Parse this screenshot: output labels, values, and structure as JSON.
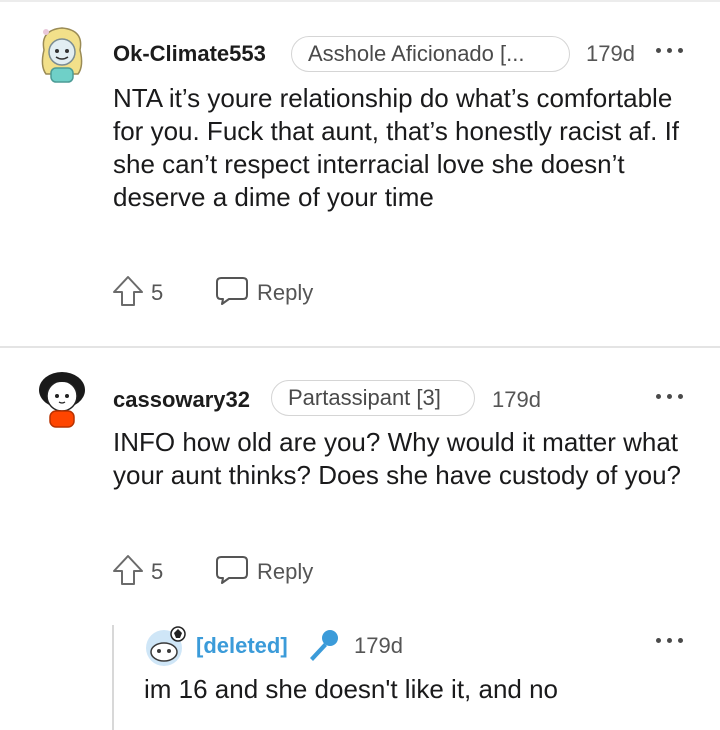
{
  "comments": [
    {
      "username": "Ok-Climate553",
      "flair": "Asshole Aficionado [...",
      "time": "179d",
      "text": "NTA it’s youre relationship do what’s comfortable for you. Fuck that aunt, that’s honestly racist af. If she can’t respect interracial love she doesn’t deserve a dime of your time",
      "votes": "5",
      "reply_label": "Reply"
    },
    {
      "username": "cassowary32",
      "flair": "Partassipant [3]",
      "time": "179d",
      "text": "INFO how old are you? Why would it matter what your aunt thinks? Does she have custody of you?",
      "votes": "5",
      "reply_label": "Reply"
    }
  ],
  "reply": {
    "username": "[deleted]",
    "time": "179d",
    "text": "im 16 and she doesn't like it, and no",
    "badge_icon": "microphone-icon",
    "accent_color": "#3b9bd9"
  },
  "icons": [
    "more-options-icon",
    "upvote-icon",
    "reply-bubble-icon"
  ]
}
